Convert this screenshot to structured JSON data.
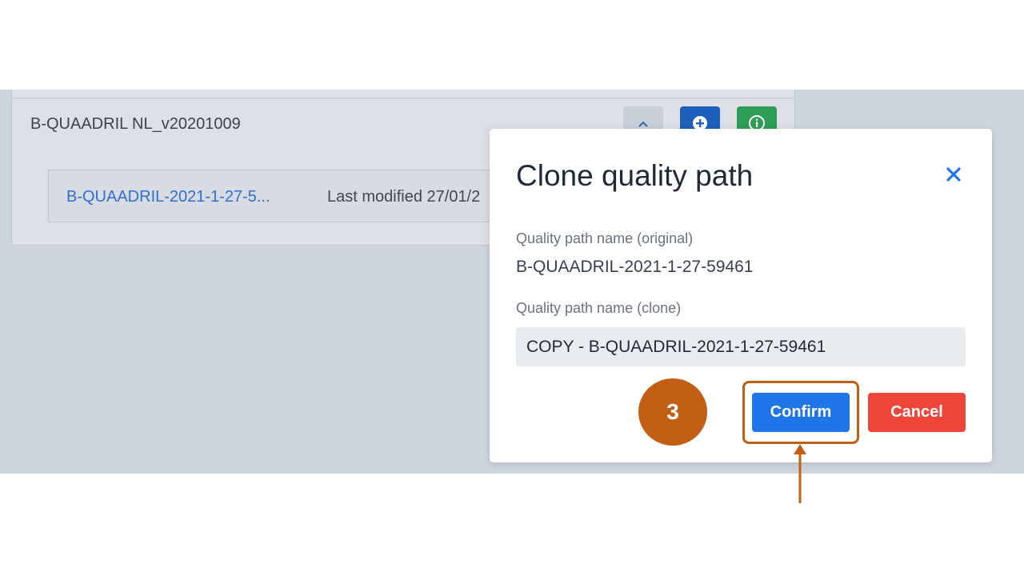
{
  "background": {
    "group_title": "B-QUAADRIL NL_v20201009",
    "path_link": "B-QUAADRIL-2021-1-27-5...",
    "path_modified": "Last modified 27/01/2",
    "icons": {
      "collapse": "chevron-up-icon",
      "add": "plus-circle-icon",
      "info": "info-circle-icon"
    }
  },
  "modal": {
    "title": "Clone quality path",
    "close_icon": "close-icon",
    "original_label": "Quality path name (original)",
    "original_value": "B-QUAADRIL-2021-1-27-59461",
    "clone_label": "Quality path name (clone)",
    "clone_value": "COPY - B-QUAADRIL-2021-1-27-59461",
    "confirm_label": "Confirm",
    "cancel_label": "Cancel"
  },
  "annotation": {
    "step_number": "3",
    "color": "#c35f14"
  },
  "colors": {
    "primary": "#1f76e8",
    "danger": "#f0453b",
    "success": "#2e9d55",
    "link": "#2f6fcf"
  }
}
